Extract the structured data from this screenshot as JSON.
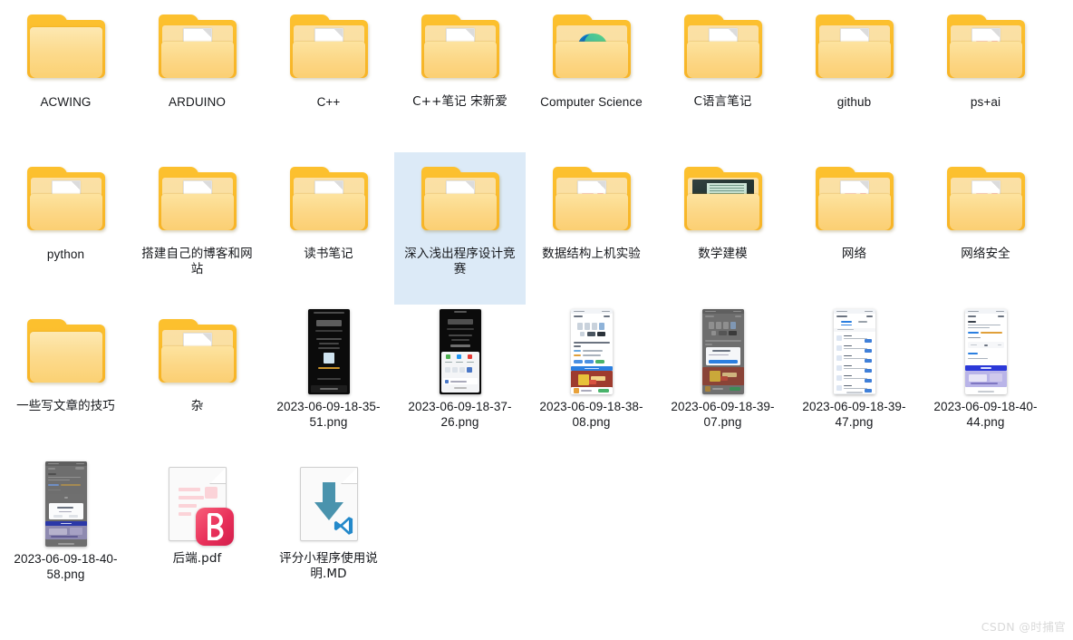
{
  "window": {
    "title": "File Explorer — Icon Grid View",
    "background_color": "#ffffff",
    "selection_color": "#dceaf7",
    "label_color": "#16181c"
  },
  "watermark": {
    "text": "CSDN @时捕官"
  },
  "grid": {
    "columns": 8,
    "rows": 4,
    "items": [
      {
        "name": "ACWING",
        "type": "folder",
        "preview": "none",
        "selected": false,
        "script": "latin"
      },
      {
        "name": "ARDUINO",
        "type": "folder",
        "preview": "md-doc",
        "selected": false,
        "script": "latin"
      },
      {
        "name": "C++",
        "type": "folder",
        "preview": "md-doc",
        "selected": false,
        "script": "latin"
      },
      {
        "name": "C++笔记 宋新爱",
        "type": "folder",
        "preview": "md-doc",
        "selected": false,
        "script": "cjk"
      },
      {
        "name": "Computer Science",
        "type": "folder",
        "preview": "edge-logo",
        "selected": false,
        "script": "latin"
      },
      {
        "name": "C语言笔记",
        "type": "folder",
        "preview": "md-doc",
        "selected": false,
        "script": "cjk"
      },
      {
        "name": "github",
        "type": "folder",
        "preview": "md-doc",
        "selected": false,
        "script": "latin"
      },
      {
        "name": "ps+ai",
        "type": "folder",
        "preview": "pink-doc",
        "selected": false,
        "script": "latin"
      },
      {
        "name": "python",
        "type": "folder",
        "preview": "md-doc",
        "selected": false,
        "script": "latin"
      },
      {
        "name": "搭建自己的博客和网站",
        "type": "folder",
        "preview": "md-doc",
        "selected": false,
        "script": "cjk"
      },
      {
        "name": "读书笔记",
        "type": "folder",
        "preview": "md-doc",
        "selected": false,
        "script": "cjk"
      },
      {
        "name": "深入浅出程序设计竞赛",
        "type": "folder",
        "preview": "md-doc",
        "selected": true,
        "script": "cjk"
      },
      {
        "name": "数据结构上机实验",
        "type": "folder",
        "preview": "pink-doc",
        "selected": false,
        "script": "cjk"
      },
      {
        "name": "数学建模",
        "type": "folder",
        "preview": "photo",
        "selected": false,
        "script": "cjk"
      },
      {
        "name": "网络",
        "type": "folder",
        "preview": "pink-doc",
        "selected": false,
        "script": "cjk"
      },
      {
        "name": "网络安全",
        "type": "folder",
        "preview": "pink-doc",
        "selected": false,
        "script": "cjk"
      },
      {
        "name": "一些写文章的技巧",
        "type": "folder",
        "preview": "none",
        "selected": false,
        "script": "cjk"
      },
      {
        "name": "杂",
        "type": "folder",
        "preview": "md-doc",
        "selected": false,
        "script": "cjk"
      },
      {
        "name": "2023-06-09-18-35-51.png",
        "type": "image",
        "preview": "phone-dark-poster",
        "selected": false,
        "script": "latin"
      },
      {
        "name": "2023-06-09-18-37-26.png",
        "type": "image",
        "preview": "phone-share-sheet",
        "selected": false,
        "script": "latin"
      },
      {
        "name": "2023-06-09-18-38-08.png",
        "type": "image",
        "preview": "phone-light-page",
        "selected": false,
        "script": "latin"
      },
      {
        "name": "2023-06-09-18-39-07.png",
        "type": "image",
        "preview": "phone-dim-dialog",
        "selected": false,
        "script": "latin"
      },
      {
        "name": "2023-06-09-18-39-47.png",
        "type": "image",
        "preview": "phone-list",
        "selected": false,
        "script": "latin"
      },
      {
        "name": "2023-06-09-18-40-44.png",
        "type": "image",
        "preview": "phone-form",
        "selected": false,
        "script": "latin"
      },
      {
        "name": "2023-06-09-18-40-58.png",
        "type": "image",
        "preview": "phone-dim-modal",
        "selected": false,
        "script": "latin"
      },
      {
        "name": "后端.pdf",
        "type": "pdf",
        "preview": "pdf-badge",
        "selected": false,
        "script": "cjk"
      },
      {
        "name": "评分小程序使用说明.MD",
        "type": "markdown",
        "preview": "md-vscode",
        "selected": false,
        "script": "cjk"
      }
    ]
  },
  "icon_semantics": {
    "folder": "folder-icon",
    "image": "image-thumbnail",
    "pdf": "pdf-file-icon",
    "markdown": "markdown-file-icon",
    "edge-logo": "microsoft-edge-icon",
    "md-doc": "markdown-document-preview-icon",
    "pink-doc": "text-document-preview-icon",
    "photo": "photo-preview-icon",
    "pdf-badge": "wps-pdf-badge-icon",
    "md-vscode": "vscode-badge-icon"
  },
  "colors": {
    "folder_back": "#fcc02e",
    "folder_front": "#fcd684",
    "folder_recess": "#fbe0a5",
    "pdf_badge": "#e8305a",
    "vscode_blue": "#2489ca",
    "md_arrow": "#3d8faf",
    "edge_blue": "#0f6cbd",
    "edge_teal": "#35c1b5"
  }
}
